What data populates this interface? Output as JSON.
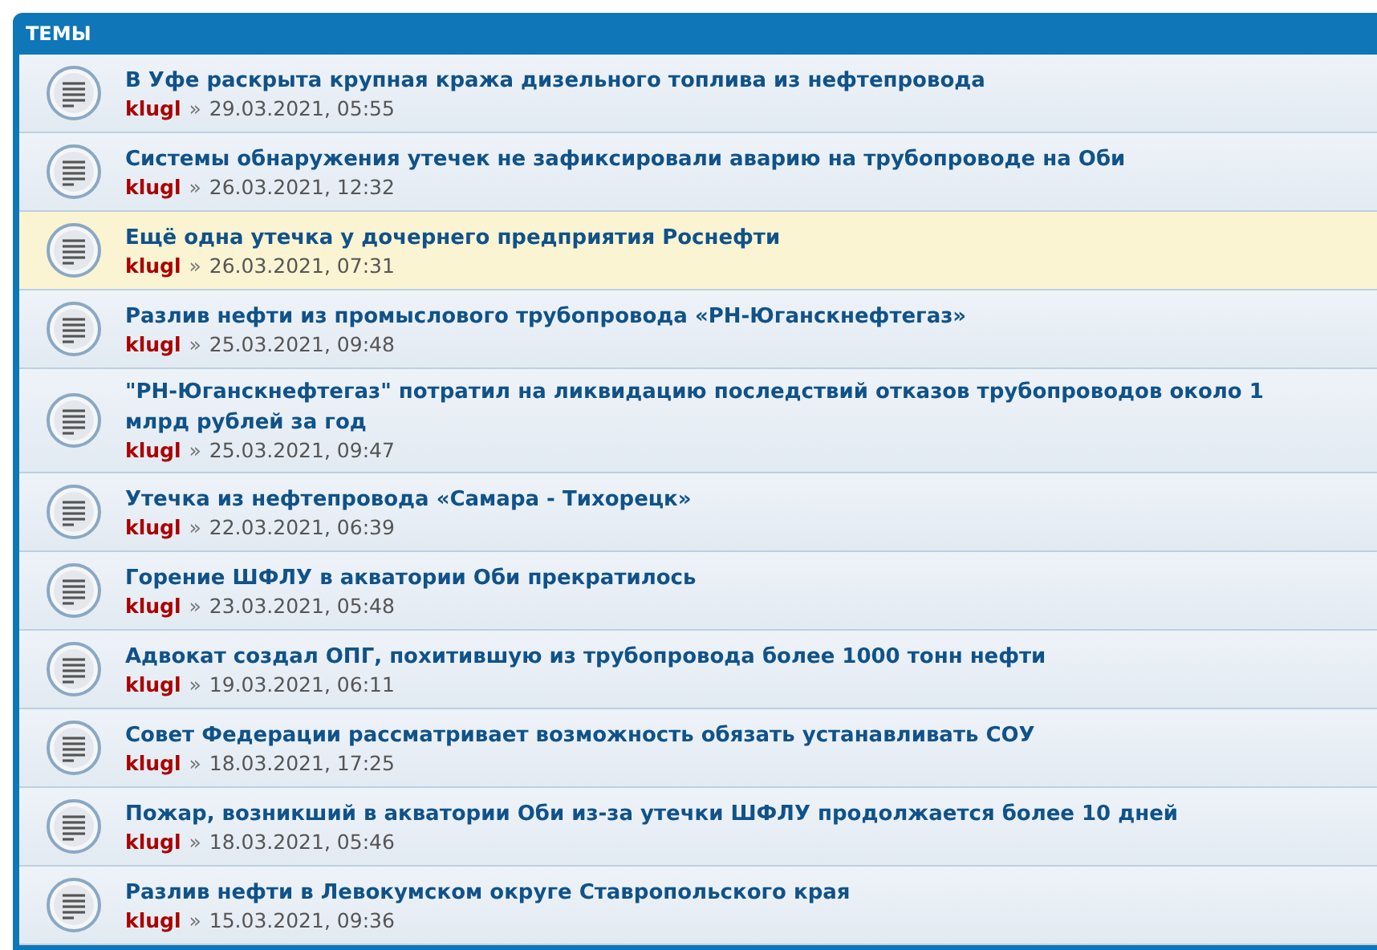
{
  "header": {
    "title": "ТЕМЫ"
  },
  "topics": [
    {
      "title": "В Уфе раскрыта крупная кража дизельного топлива из нефтепровода",
      "author": "klugl",
      "separator": "»",
      "date": "29.03.2021, 05:55",
      "highlighted": false
    },
    {
      "title": "Системы обнаружения утечек не зафиксировали аварию на трубопроводе на Оби",
      "author": "klugl",
      "separator": "»",
      "date": "26.03.2021, 12:32",
      "highlighted": false
    },
    {
      "title": "Ещё одна утечка у дочернего предприятия Роснефти",
      "author": "klugl",
      "separator": "»",
      "date": "26.03.2021, 07:31",
      "highlighted": true
    },
    {
      "title": "Разлив нефти из промыслового трубопровода «РН-Юганскнефтегаз»",
      "author": "klugl",
      "separator": "»",
      "date": "25.03.2021, 09:48",
      "highlighted": false
    },
    {
      "title": "\"РН-Юганскнефтегаз\" потратил на ликвидацию последствий отказов трубопроводов около 1 млрд рублей за год",
      "author": "klugl",
      "separator": "»",
      "date": "25.03.2021, 09:47",
      "highlighted": false
    },
    {
      "title": "Утечка из нефтепровода «Самара - Тихорецк»",
      "author": "klugl",
      "separator": "»",
      "date": "22.03.2021, 06:39",
      "highlighted": false
    },
    {
      "title": "Горение ШФЛУ в акватории Оби прекратилось",
      "author": "klugl",
      "separator": "»",
      "date": "23.03.2021, 05:48",
      "highlighted": false
    },
    {
      "title": "Адвокат создал ОПГ, похитившую из трубопровода более 1000 тонн нефти",
      "author": "klugl",
      "separator": "»",
      "date": "19.03.2021, 06:11",
      "highlighted": false
    },
    {
      "title": "Совет Федерации рассматривает возможность обязать устанавливать СОУ",
      "author": "klugl",
      "separator": "»",
      "date": "18.03.2021, 17:25",
      "highlighted": false
    },
    {
      "title": "Пожар, возникший в акватории Оби из-за утечки ШФЛУ продолжается более 10 дней",
      "author": "klugl",
      "separator": "»",
      "date": "18.03.2021, 05:46",
      "highlighted": false
    },
    {
      "title": "Разлив нефти в Левокумском округе Ставропольского края",
      "author": "klugl",
      "separator": "»",
      "date": "15.03.2021, 09:36",
      "highlighted": false
    }
  ]
}
